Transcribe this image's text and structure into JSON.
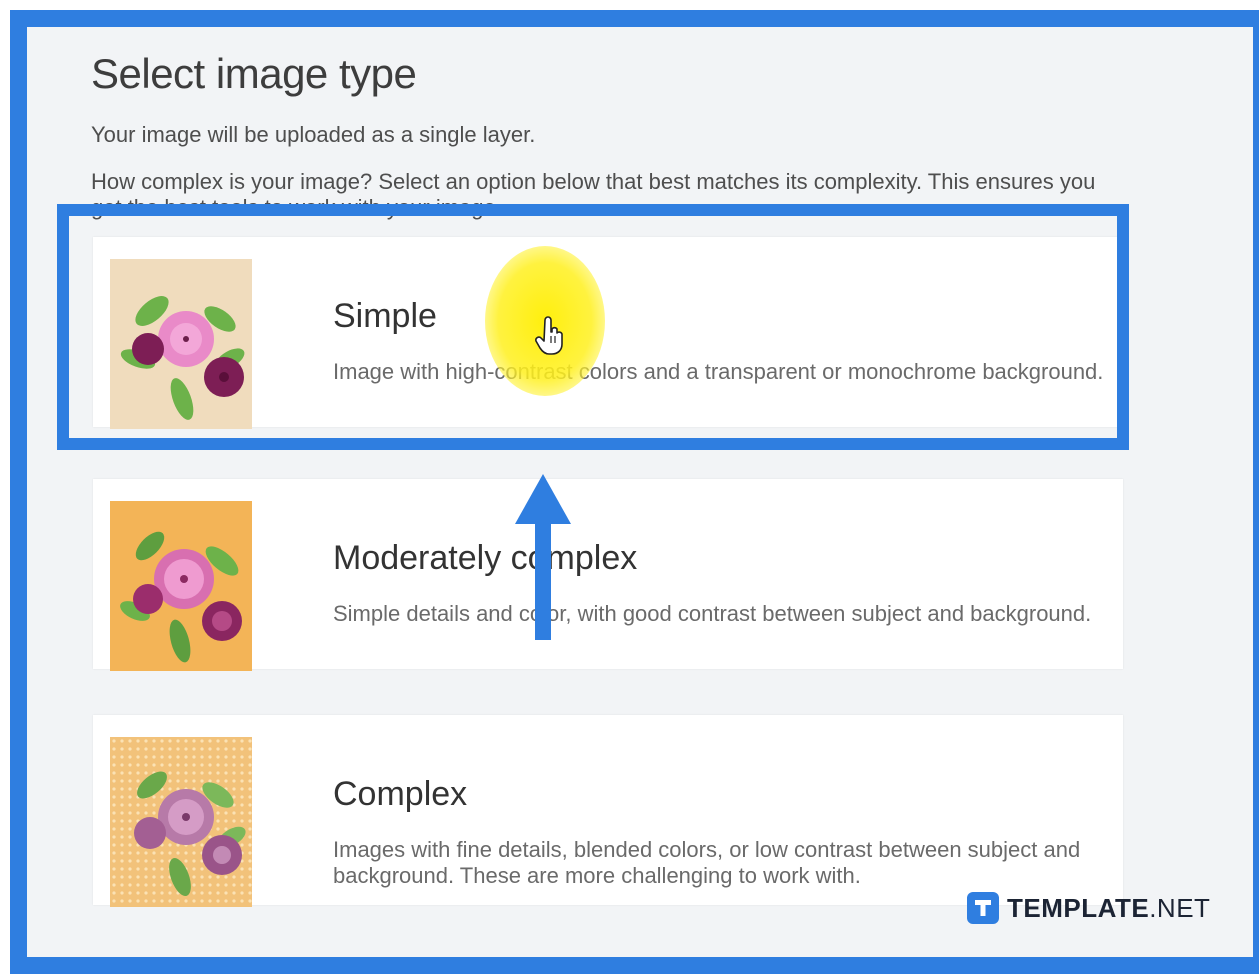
{
  "header": {
    "title": "Select image type",
    "subtitle": "Your image will be uploaded as a single layer.",
    "description": "How complex is your image? Select an option below that best matches its complexity. This ensures you get the best tools to work with your image."
  },
  "options": [
    {
      "title": "Simple",
      "description": "Image with high-contrast colors and a transparent or monochrome background.",
      "thumb_bg": "#f0dcbd",
      "selected": true
    },
    {
      "title": "Moderately complex",
      "description": "Simple details and color, with good contrast between subject and background.",
      "thumb_bg": "#f3b457"
    },
    {
      "title": "Complex",
      "description": "Images with fine details, blended colors, or low contrast between subject and background. These are more challenging to work with.",
      "thumb_bg": "#f2c27a"
    }
  ],
  "annotations": {
    "highlight_color": "#2f7ee0",
    "cursor_highlight_color": "#ffee00",
    "cursor_icon": "hand-pointer-icon",
    "arrow_icon": "arrow-up-icon"
  },
  "watermark": {
    "brand_bold": "TEMPLATE",
    "brand_suffix": ".NET",
    "logo_letter": "T"
  }
}
